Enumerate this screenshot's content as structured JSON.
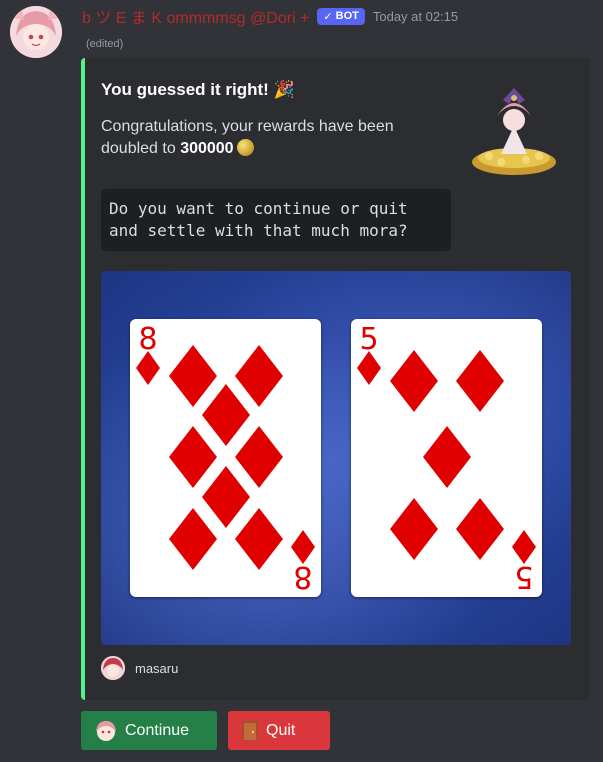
{
  "message": {
    "username": "b ツ E ま K ommmmsg @Dori +",
    "bot_badge": "BOT",
    "timestamp": "Today at 02:15",
    "edited_label": "(edited)"
  },
  "embed": {
    "accent_color": "#57f287",
    "title": "You guessed it right! 🎉",
    "description_prefix": "Congratulations, your rewards have been doubled to ",
    "reward_amount": "300000",
    "code_text": "Do you want to continue or quit\nand settle with that much mora?",
    "footer_text": "masaru",
    "cards": [
      {
        "rank": "8",
        "suit": "diamonds"
      },
      {
        "rank": "5",
        "suit": "diamonds"
      }
    ]
  },
  "buttons": {
    "continue_label": "Continue",
    "quit_label": "Quit"
  },
  "colors": {
    "background": "#313338",
    "embed_bg": "#2b2d31",
    "continue_green": "#248046",
    "quit_red": "#da373c",
    "bot_badge": "#5865f2",
    "username": "#b42a2a",
    "card_red": "#e00000"
  }
}
